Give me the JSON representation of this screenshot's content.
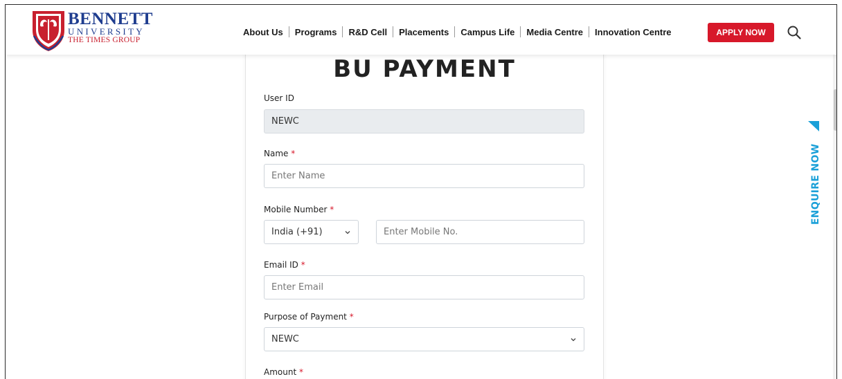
{
  "header": {
    "logo": {
      "name": "BENNETT",
      "sub": "UNIVERSITY",
      "group": "THE TIMES GROUP"
    },
    "nav": [
      "About Us",
      "Programs",
      "R&D Cell",
      "Placements",
      "Campus Life",
      "Media Centre",
      "Innovation Centre"
    ],
    "apply_label": "APPLY NOW",
    "search_icon": "search-icon"
  },
  "form": {
    "title": "BU PAYMENT",
    "user_id": {
      "label": "User ID",
      "value": "NEWC"
    },
    "name": {
      "label": "Name",
      "placeholder": "Enter Name"
    },
    "mobile": {
      "label": "Mobile Number",
      "country": "India (+91)",
      "placeholder": "Enter Mobile No."
    },
    "email": {
      "label": "Email ID",
      "placeholder": "Enter Email"
    },
    "purpose": {
      "label": "Purpose of Payment",
      "value": "NEWC"
    },
    "amount": {
      "label": "Amount"
    },
    "required_mark": "*"
  },
  "enquire": {
    "label": "ENQUIRE NOW"
  },
  "colors": {
    "brand_red": "#d7182a",
    "brand_blue": "#1f3d8f",
    "enquire_blue": "#1aa0d8"
  }
}
